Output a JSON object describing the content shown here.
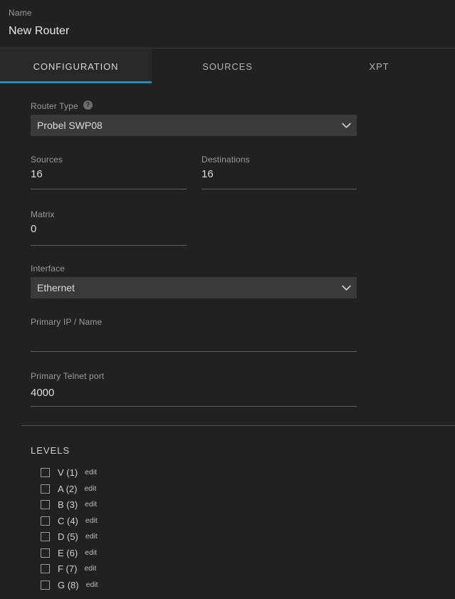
{
  "header": {
    "label": "Name",
    "value": "New Router"
  },
  "tabs": [
    {
      "label": "CONFIGURATION",
      "active": true
    },
    {
      "label": "SOURCES",
      "active": false
    },
    {
      "label": "XPT",
      "active": false
    }
  ],
  "form": {
    "router_type": {
      "label": "Router Type",
      "help_icon": "help-circle-icon",
      "help_glyph": "?",
      "value": "Probel SWP08"
    },
    "sources": {
      "label": "Sources",
      "value": "16"
    },
    "destinations": {
      "label": "Destinations",
      "value": "16"
    },
    "matrix": {
      "label": "Matrix",
      "value": "0"
    },
    "interface": {
      "label": "Interface",
      "value": "Ethernet"
    },
    "primary_ip": {
      "label": "Primary IP / Name",
      "value": ""
    },
    "primary_telnet_port": {
      "label": "Primary Telnet port",
      "value": "4000"
    }
  },
  "levels": {
    "title": "LEVELS",
    "edit_label": "edit",
    "items": [
      {
        "name": "V (1)",
        "checked": false
      },
      {
        "name": "A (2)",
        "checked": false
      },
      {
        "name": "B (3)",
        "checked": false
      },
      {
        "name": "C (4)",
        "checked": false
      },
      {
        "name": "D (5)",
        "checked": false
      },
      {
        "name": "E (6)",
        "checked": false
      },
      {
        "name": "F (7)",
        "checked": false
      },
      {
        "name": "G (8)",
        "checked": false
      }
    ]
  },
  "colors": {
    "background": "#212121",
    "panel": "#282828",
    "accent": "#2b86b8",
    "field_bg": "#3a3a3a",
    "label_text": "#9a9a9a",
    "value_text": "#dcdcdc",
    "underline": "#5e5e5e"
  }
}
